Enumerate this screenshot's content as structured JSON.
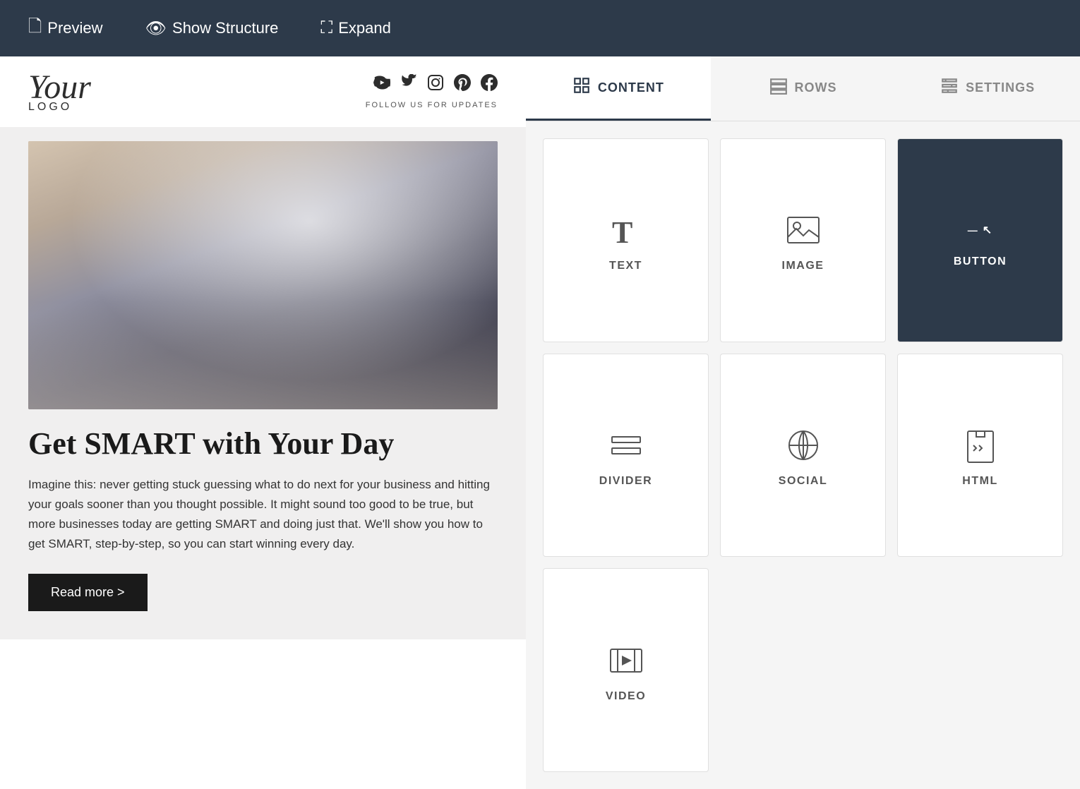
{
  "toolbar": {
    "preview_label": "Preview",
    "show_structure_label": "Show Structure",
    "expand_label": "Expand"
  },
  "email": {
    "logo_text": "Your",
    "logo_sub": "LOGO",
    "follow_text": "FOLLOW US FOR UPDATES",
    "social_icons": [
      "▶",
      "🐦",
      "📷",
      "📌",
      "f"
    ],
    "article_heading": "Get SMART with Your Day",
    "article_body": "Imagine this: never getting stuck guessing what to do next for your business and hitting your goals sooner than you thought possible. It might sound too good to be true, but more businesses today are getting SMART and doing just that. We'll show you how to get SMART, step-by-step, so you can start winning every day.",
    "read_more_label": "Read more >"
  },
  "sidebar": {
    "tabs": [
      {
        "id": "content",
        "label": "CONTENT",
        "active": true
      },
      {
        "id": "rows",
        "label": "ROWS",
        "active": false
      },
      {
        "id": "settings",
        "label": "SETTINGS",
        "active": false
      }
    ],
    "content_items": [
      {
        "id": "text",
        "label": "TEXT"
      },
      {
        "id": "image",
        "label": "IMAGE"
      },
      {
        "id": "button",
        "label": "BUTTON"
      },
      {
        "id": "divider",
        "label": "DIVIDER"
      },
      {
        "id": "social",
        "label": "SOCIAL"
      },
      {
        "id": "html",
        "label": "HTML"
      },
      {
        "id": "video",
        "label": "VIDEO"
      }
    ]
  }
}
